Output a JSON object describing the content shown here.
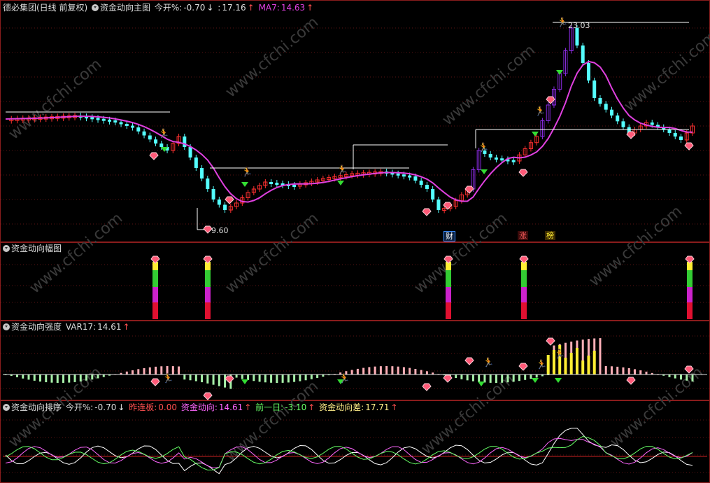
{
  "panel1": {
    "stock": "德必集团(日线 前复权)",
    "indicator": "资金动向主图",
    "open_pct_label": "今开%:",
    "open_pct_value": "-0.70",
    "field2_label": ":",
    "field2_value": "17.16",
    "ma7_label": "MA7:",
    "ma7_value": "14.63",
    "high_label": "23.03",
    "low_label": "9.60",
    "tags": [
      "财",
      "涨",
      "榜"
    ]
  },
  "panel2": {
    "title": "资金动向幅图"
  },
  "panel3": {
    "title": "资金动向强度",
    "var_label": "VAR17:",
    "var_value": "14.61"
  },
  "panel4": {
    "title": "资金动向排序",
    "open_pct_label": "今开%:",
    "open_pct_value": "-0.70",
    "limit_label": "昨连板:",
    "limit_value": "0.00",
    "flow_label": "资金动向:",
    "flow_value": "14.61",
    "prev_label": "前一日:",
    "prev_value": "-3.10",
    "diff_label": "资金动向差:",
    "diff_value": "17.71"
  },
  "watermark": "www.cfchi.com",
  "colors": {
    "background": "#000000",
    "panel_border": "#8a1c1c",
    "grid": "#5a1414",
    "up_candle": "#ff3030",
    "down_candle": "#54ffff",
    "ma7": "#e040e0",
    "big_up": "#8a2be2",
    "level_line": "#ffffff",
    "bar_red": "#e01030",
    "bar_magenta": "#cc22cc",
    "bar_green": "#33cc33",
    "bar_yellow": "#ffee33",
    "hist_green": "#a8f0a8",
    "hist_pink": "#ffb0b8",
    "line_white": "#ffffff",
    "line_pink": "#ff66ff",
    "line_green": "#66ff66"
  },
  "chart_data": {
    "type": "candlestick",
    "panels": 4,
    "ma_period": 7,
    "high": 23.03,
    "low": 9.6
  }
}
